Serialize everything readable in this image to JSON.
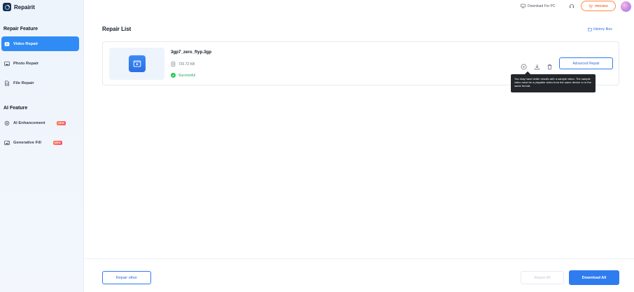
{
  "app": {
    "name": "Repairit",
    "logo_icon": "repairit-logo-icon"
  },
  "sidebar": {
    "repair_section_title": "Repair Feature",
    "repair_items": [
      {
        "label": "Video Repair",
        "icon": "video-icon",
        "active": true
      },
      {
        "label": "Photo Repair",
        "icon": "photo-icon",
        "active": false
      },
      {
        "label": "File Repair",
        "icon": "file-icon",
        "active": false
      }
    ],
    "ai_section_title": "AI Feature",
    "ai_items": [
      {
        "label": "AI Enhancement",
        "icon": "sparkle-icon",
        "badge": "NEW"
      },
      {
        "label": "Generative Fill",
        "icon": "image-fill-icon",
        "badge": "NEW"
      }
    ]
  },
  "header": {
    "download_label": "Download For PC",
    "download_icon": "monitor-icon",
    "help_icon": "headset-icon",
    "pricing_label": "PRICING",
    "pricing_icon": "cart-icon"
  },
  "main": {
    "title": "Repair List",
    "history_label": "History files",
    "history_icon": "folder-icon",
    "files": [
      {
        "name": "3gp7_zero_ftyp.3gp",
        "size": "720.72 KB",
        "status": "Successful",
        "actions": [
          "play-icon",
          "download-icon",
          "trash-icon"
        ],
        "advanced_label": "Advanced Repair"
      }
    ],
    "tooltip": "You may have better results with a sample video. The sample video must be a playable video from the same device or in the same format."
  },
  "footer": {
    "repair_other_label": "Repair other",
    "repair_all_label": "Repair All",
    "download_all_label": "Download All"
  },
  "colors": {
    "accent": "#2f7cf0",
    "success": "#22c55e",
    "pricing": "#ff6a2e",
    "new_badge": "#ff5a5a"
  }
}
